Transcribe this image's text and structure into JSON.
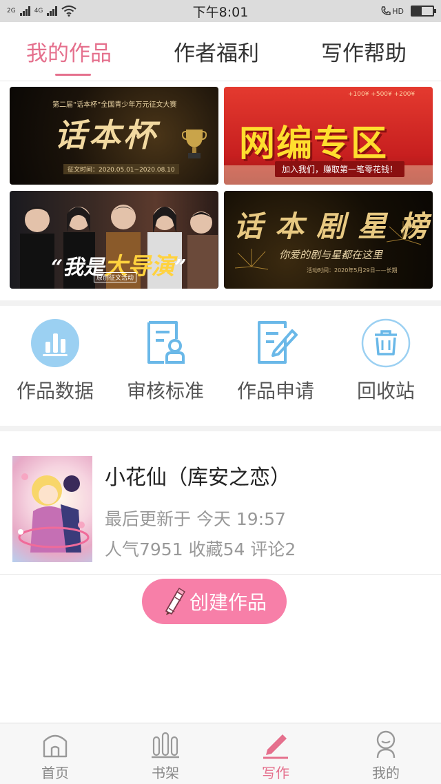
{
  "status_bar": {
    "sim1": "2G",
    "sim2": "4G",
    "time": "下午8:01",
    "hd": "HD"
  },
  "tabs": [
    {
      "label": "我的作品",
      "active": true
    },
    {
      "label": "作者福利",
      "active": false
    },
    {
      "label": "写作帮助",
      "active": false
    }
  ],
  "banners": {
    "b1": {
      "subtitle": "第二届“话本杯”全国青少年万元征文大赛",
      "title": "话本杯",
      "dates": "征文时间：2020.05.01~2020.08.10"
    },
    "b2": {
      "amounts": "+100¥ +500¥ +200¥",
      "title": "网编专区",
      "slogan": "加入我们，赚取第一笔零花钱！"
    },
    "b3": {
      "title_prefix": "“我是",
      "title_main": "大导演",
      "title_suffix": "”",
      "tag": "原创征文活动"
    },
    "b4": {
      "title": "话本剧星榜",
      "subtitle": "你爱的剧与星都在这里",
      "dates": "活动时间：2020年5月29日——长期"
    }
  },
  "quick_actions": [
    {
      "label": "作品数据",
      "icon": "bar-chart-icon"
    },
    {
      "label": "审核标准",
      "icon": "review-document-icon"
    },
    {
      "label": "作品申请",
      "icon": "edit-document-icon"
    },
    {
      "label": "回收站",
      "icon": "trash-icon"
    }
  ],
  "work": {
    "title": "小花仙（库安之恋）",
    "updated": "最后更新于 今天 19:57",
    "stats": "人气7951 收藏54 评论2"
  },
  "create_button": {
    "label": "创建作品",
    "icon": "pencil-icon"
  },
  "bottom_nav": [
    {
      "label": "首页",
      "icon": "home-icon",
      "active": false
    },
    {
      "label": "书架",
      "icon": "bookshelf-icon",
      "active": false
    },
    {
      "label": "写作",
      "icon": "pen-icon",
      "active": true
    },
    {
      "label": "我的",
      "icon": "profile-icon",
      "active": false
    }
  ],
  "colors": {
    "accent": "#e5708d",
    "button_pink": "#f77fa8",
    "icon_blue": "#6ab8e8"
  }
}
